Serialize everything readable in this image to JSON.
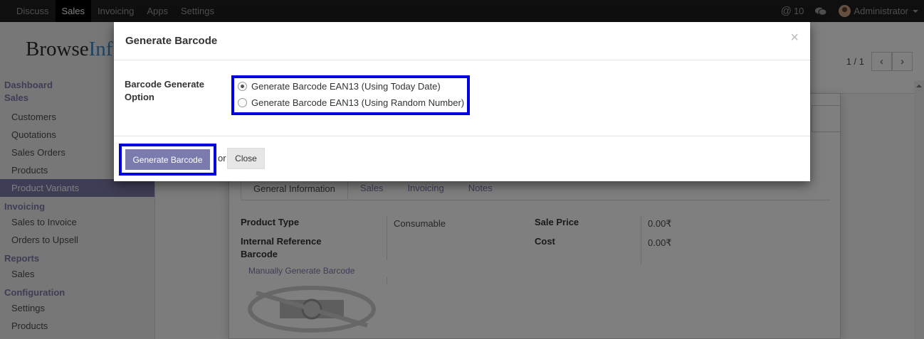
{
  "topbar": {
    "menu": [
      "Discuss",
      "Sales",
      "Invoicing",
      "Apps",
      "Settings"
    ],
    "active_index": 1,
    "activity_count": "10",
    "user": "Administrator"
  },
  "sidebar": {
    "logo_dark": "Browse",
    "logo_blue": "Inf",
    "dashboard": "Dashboard",
    "sales_section": "Sales",
    "sales_items": [
      "Customers",
      "Quotations",
      "Sales Orders",
      "Products",
      "Product Variants"
    ],
    "invoicing_section": "Invoicing",
    "invoicing_items": [
      "Sales to Invoice",
      "Orders to Upsell"
    ],
    "reports_section": "Reports",
    "reports_items": [
      "Sales"
    ],
    "config_section": "Configuration",
    "config_items": [
      "Settings",
      "Products"
    ]
  },
  "main": {
    "pager": "1 / 1",
    "tabs": [
      "General Information",
      "Sales",
      "Invoicing",
      "Notes"
    ],
    "product_type_label": "Product Type",
    "product_type_value": "Consumable",
    "internal_ref_label": "Internal Reference",
    "barcode_label": "Barcode",
    "manual_link": "Manually Generate Barcode",
    "sale_price_label": "Sale Price",
    "sale_price_value": "0.00₹",
    "cost_label": "Cost",
    "cost_value": "0.00₹"
  },
  "modal": {
    "title": "Generate Barcode",
    "close_symbol": "×",
    "option_label": "Barcode Generate Option",
    "options": [
      "Generate Barcode EAN13 (Using Today Date)",
      "Generate Barcode EAN13 (Using Random Number)"
    ],
    "selected_option": 0,
    "generate_button": "Generate Barcode",
    "or_text": "or",
    "close_button": "Close"
  },
  "colors": {
    "topbar": "#1f1f1f",
    "accent": "#7c7bad",
    "highlight_border": "#0000e0"
  },
  "icons": [
    "at-icon",
    "chat-icon",
    "avatar",
    "chevron-left-icon",
    "chevron-right-icon",
    "close-icon",
    "no-image-camera-icon"
  ]
}
